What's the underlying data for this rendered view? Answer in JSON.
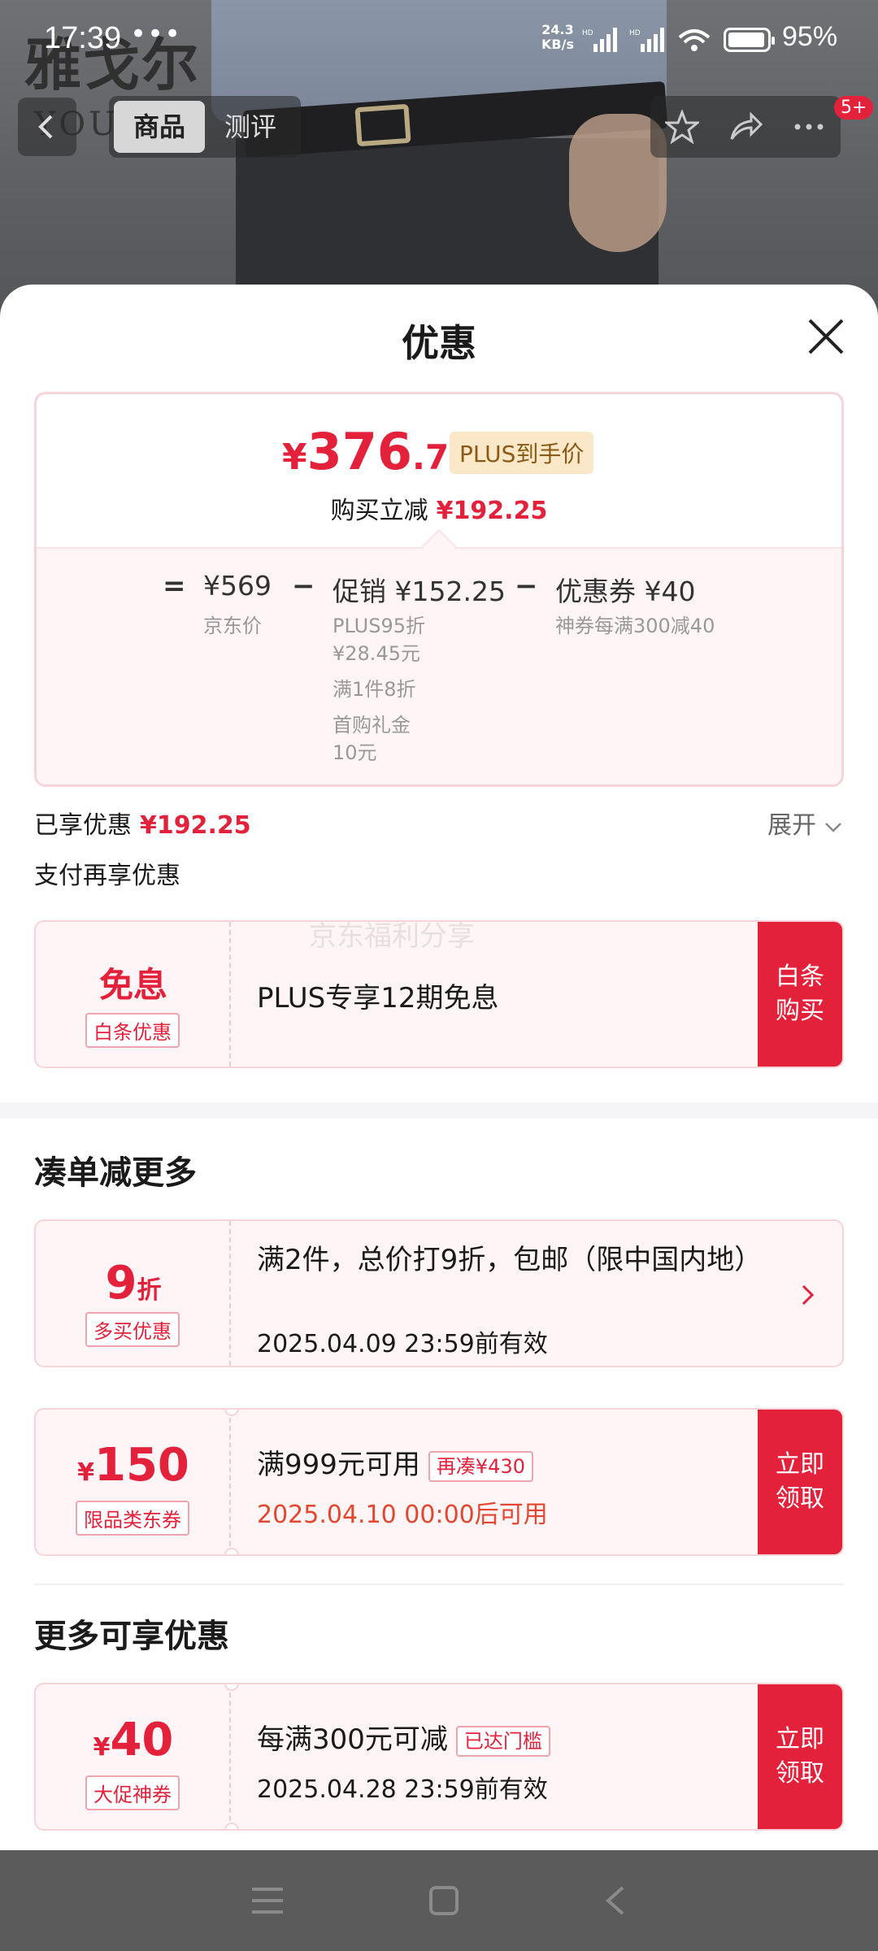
{
  "status_bar": {
    "time": "17:39",
    "dots": "•••",
    "net_speed_top": "24.3",
    "net_speed_bottom": "KB/s",
    "battery": "95%"
  },
  "product_header": {
    "brand_logo": "雅戈尔",
    "brand_sub": "YOUN",
    "tabs": [
      {
        "label": "商品"
      },
      {
        "label": "测评"
      }
    ],
    "cart_badge": "5+"
  },
  "sheet": {
    "title": "优惠",
    "summary": {
      "yen": "¥",
      "price_int": "376",
      "price_dec": ".75",
      "plus_tag": "PLUS到手价",
      "reduce_label": "购买立减",
      "reduce_value": "¥192.25",
      "breakdown": {
        "eq": "=",
        "base_value": "¥569",
        "base_label": "京东价",
        "minus1": "−",
        "promo_value": "促销 ¥152.25",
        "promo_lines": [
          "PLUS95折",
          "¥28.45元",
          "满1件8折",
          "首购礼金",
          "10元"
        ],
        "minus2": "−",
        "coupon_value": "优惠券 ¥40",
        "coupon_label": "神券每满300减40"
      }
    },
    "enjoyed_label": "已享优惠",
    "enjoyed_value": "¥192.25",
    "expand_label": "展开",
    "pay_more_label": "支付再享优惠",
    "watermark": "京东福利分享",
    "baitiao": {
      "big": "免息",
      "tag": "白条优惠",
      "main": "PLUS专享12期免息",
      "button": "白条购买"
    },
    "section_combine": "凑单减更多",
    "multi_buy": {
      "big_num": "9",
      "big_unit": "折",
      "tag": "多买优惠",
      "main": "满2件，总价打9折，包邮（限中国内地）",
      "sub": "2025.04.09 23:59前有效"
    },
    "jd_coupon": {
      "yen": "¥",
      "amount": "150",
      "tag": "限品类东券",
      "main": "满999元可用",
      "chip": "再凑¥430",
      "sub": "2025.04.10 00:00后可用",
      "button": "立即领取"
    },
    "section_more": "更多可享优惠",
    "promo_coupon": {
      "yen": "¥",
      "amount": "40",
      "tag": "大促神券",
      "main": "每满300元可减",
      "chip": "已达门槛",
      "sub": "2025.04.28 23:59前有效",
      "button": "立即领取"
    }
  },
  "colors": {
    "accent_red": "#e4213b",
    "card_bg": "#fff5f6",
    "plus_gold": "#fbe8c9"
  }
}
